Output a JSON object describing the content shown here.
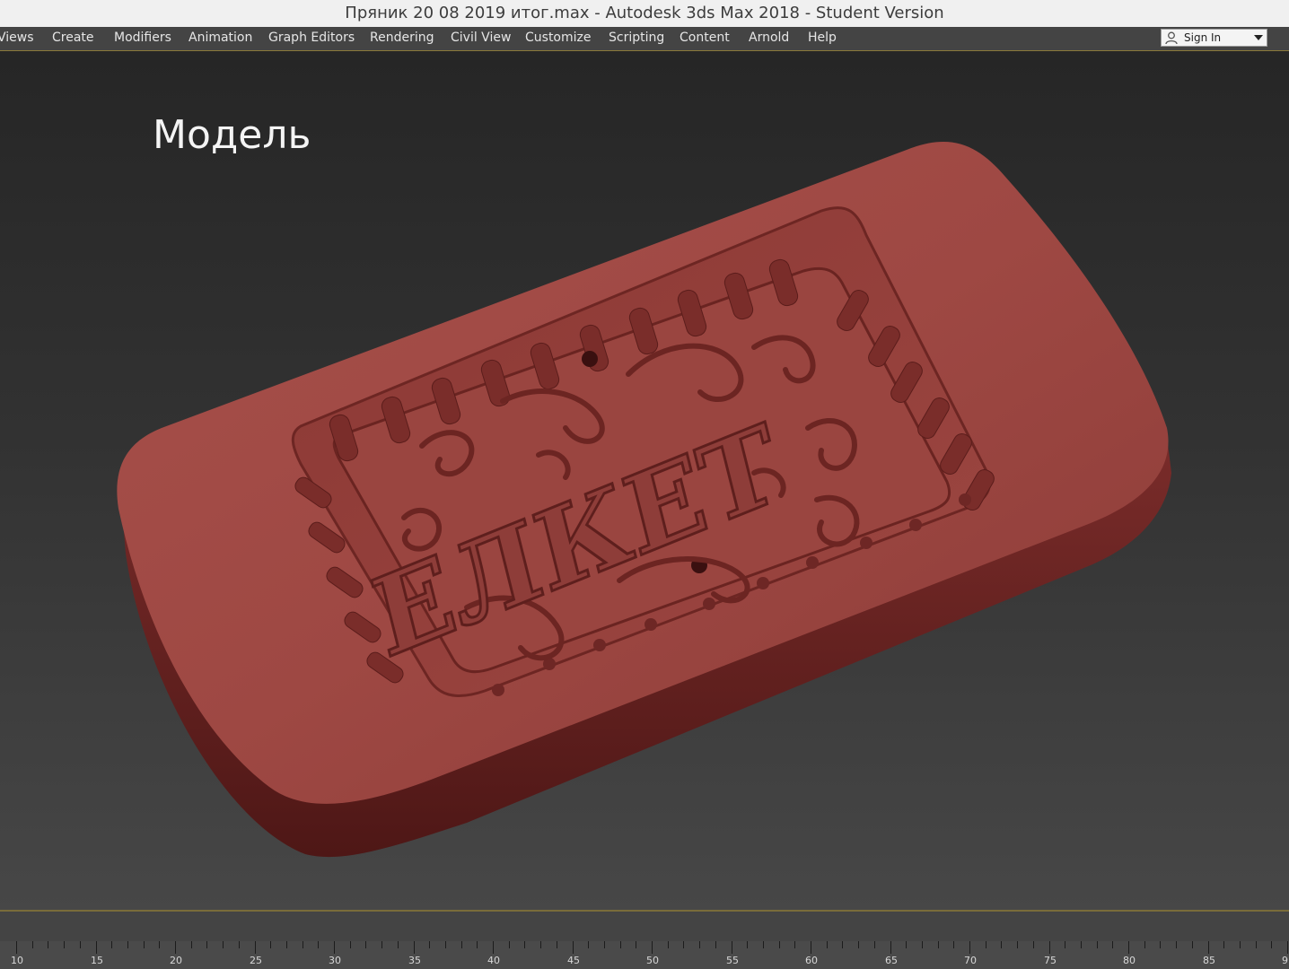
{
  "window": {
    "title": "Пряник 20 08 2019 итог.max - Autodesk 3ds Max 2018 - Student Version"
  },
  "menu": {
    "items": [
      "Views",
      "Create",
      "Modifiers",
      "Animation",
      "Graph Editors",
      "Rendering",
      "Civil View",
      "Customize",
      "Scripting",
      "Content",
      "Arnold",
      "Help"
    ]
  },
  "account": {
    "signin_label": "Sign In",
    "icon": "user-icon"
  },
  "viewport": {
    "label": "Модель",
    "model_text": "ЕЛКЕТ",
    "object_color": "#a04a44",
    "background_top": "#262626",
    "background_bottom": "#474747"
  },
  "timeline": {
    "labels": [
      "10",
      "15",
      "20",
      "25",
      "30",
      "35",
      "40",
      "45",
      "50",
      "55",
      "60",
      "65",
      "70",
      "75",
      "80",
      "85",
      "9"
    ]
  },
  "colors": {
    "accent_line": "#8a7a3a",
    "menubar": "#444444",
    "titlebar": "#f0f0f0"
  }
}
